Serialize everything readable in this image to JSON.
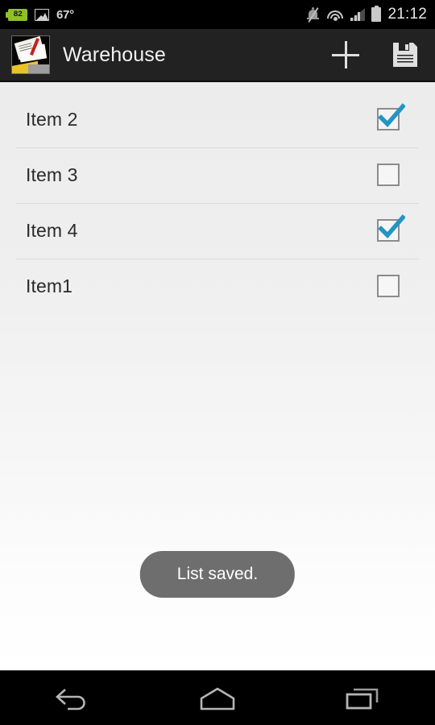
{
  "status_bar": {
    "battery_percent": "82",
    "battery_icon": "battery-green-icon",
    "gallery_icon": "gallery-picture-icon",
    "temperature": "67°",
    "silent_icon": "bell-muted-icon",
    "wifi_icon": "wifi-signal-icon",
    "cell_icon": "cellular-signal-icon",
    "battery_status_icon": "battery-icon",
    "time": "21:12"
  },
  "action_bar": {
    "app_icon": "warehouse-app-icon",
    "title": "Warehouse",
    "add_label": "add-item",
    "add_icon": "plus-icon",
    "save_label": "save-list",
    "save_icon": "floppy-disk-save-icon"
  },
  "list": {
    "items": [
      {
        "label": "Item 2",
        "checked": true
      },
      {
        "label": "Item 3",
        "checked": false
      },
      {
        "label": "Item 4",
        "checked": true
      },
      {
        "label": "Item1",
        "checked": false
      }
    ]
  },
  "toast": {
    "message": "List saved."
  },
  "nav_bar": {
    "back_icon": "back-arrow-icon",
    "home_icon": "home-icon",
    "recents_icon": "recent-apps-icon"
  },
  "colors": {
    "accent_check": "#2494c4",
    "action_bar_bg": "#222222",
    "toast_bg": "#6e6e6e",
    "battery_green": "#8fc028"
  }
}
